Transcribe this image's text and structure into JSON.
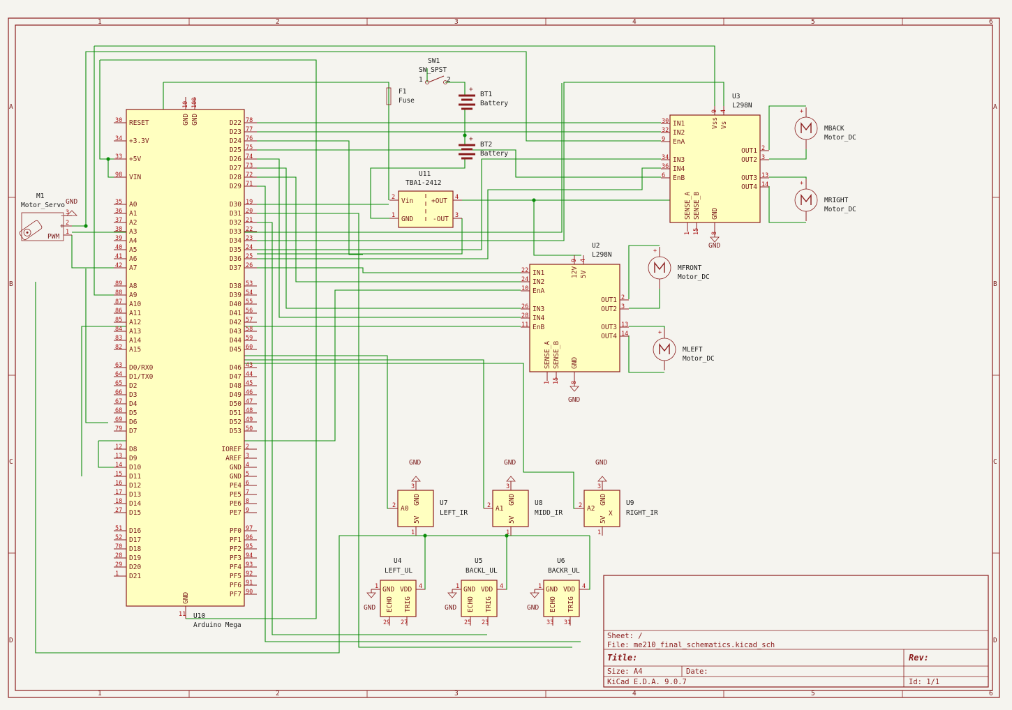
{
  "frame": {
    "col_labels": [
      "1",
      "2",
      "3",
      "4",
      "5",
      "6"
    ],
    "row_labels": [
      "A",
      "B",
      "C",
      "D"
    ]
  },
  "title_block": {
    "sheet": "Sheet: /",
    "file": "File: me210_final_schematics.kicad_sch",
    "title": "Title:",
    "size": "Size: A4",
    "date": "Date:",
    "rev": "Rev:",
    "tool": "KiCad E.D.A. 9.0.7",
    "id": "Id: 1/1"
  },
  "components": {
    "u10": {
      "ref": "U10",
      "value": "Arduino Mega",
      "left_pins": [
        {
          "name": "RESET",
          "num": "30"
        },
        {
          "name": "+3.3V",
          "num": "34"
        },
        {
          "name": "+5V",
          "num": "33"
        },
        {
          "name": "VIN",
          "num": "98"
        },
        {
          "name": "A0",
          "num": "35"
        },
        {
          "name": "A1",
          "num": "36"
        },
        {
          "name": "A2",
          "num": "37"
        },
        {
          "name": "A3",
          "num": "38"
        },
        {
          "name": "A4",
          "num": "39"
        },
        {
          "name": "A5",
          "num": "40"
        },
        {
          "name": "A6",
          "num": "41"
        },
        {
          "name": "A7",
          "num": "42"
        },
        {
          "name": "A8",
          "num": "89"
        },
        {
          "name": "A9",
          "num": "88"
        },
        {
          "name": "A10",
          "num": "87"
        },
        {
          "name": "A11",
          "num": "86"
        },
        {
          "name": "A12",
          "num": "85"
        },
        {
          "name": "A13",
          "num": "84"
        },
        {
          "name": "A14",
          "num": "83"
        },
        {
          "name": "A15",
          "num": "82"
        },
        {
          "name": "D0/RX0",
          "num": "63"
        },
        {
          "name": "D1/TX0",
          "num": "64"
        },
        {
          "name": "D2",
          "num": "65"
        },
        {
          "name": "D3",
          "num": "66"
        },
        {
          "name": "D4",
          "num": "67"
        },
        {
          "name": "D5",
          "num": "68"
        },
        {
          "name": "D6",
          "num": "69"
        },
        {
          "name": "D7",
          "num": "79"
        },
        {
          "name": "D8",
          "num": "12"
        },
        {
          "name": "D9",
          "num": "13"
        },
        {
          "name": "D10",
          "num": "14"
        },
        {
          "name": "D11",
          "num": "15"
        },
        {
          "name": "D12",
          "num": "16"
        },
        {
          "name": "D13",
          "num": "17"
        },
        {
          "name": "D14",
          "num": "18"
        },
        {
          "name": "D15",
          "num": "27"
        },
        {
          "name": "D16",
          "num": "51"
        },
        {
          "name": "D17",
          "num": "52"
        },
        {
          "name": "D18",
          "num": "70"
        },
        {
          "name": "D19",
          "num": "28"
        },
        {
          "name": "D20",
          "num": "29"
        },
        {
          "name": "D21",
          "num": "1"
        }
      ],
      "right_pins": [
        {
          "name": "D22",
          "num": "78"
        },
        {
          "name": "D23",
          "num": "77"
        },
        {
          "name": "D24",
          "num": "76"
        },
        {
          "name": "D25",
          "num": "75"
        },
        {
          "name": "D26",
          "num": "74"
        },
        {
          "name": "D27",
          "num": "73"
        },
        {
          "name": "D28",
          "num": "72"
        },
        {
          "name": "D29",
          "num": "71"
        },
        {
          "name": "D30",
          "num": "19"
        },
        {
          "name": "D31",
          "num": "20"
        },
        {
          "name": "D32",
          "num": "21"
        },
        {
          "name": "D33",
          "num": "22"
        },
        {
          "name": "D34",
          "num": "23"
        },
        {
          "name": "D35",
          "num": "24"
        },
        {
          "name": "D36",
          "num": "25"
        },
        {
          "name": "D37",
          "num": "26"
        },
        {
          "name": "D38",
          "num": "53"
        },
        {
          "name": "D39",
          "num": "54"
        },
        {
          "name": "D40",
          "num": "55"
        },
        {
          "name": "D41",
          "num": "56"
        },
        {
          "name": "D42",
          "num": "57"
        },
        {
          "name": "D43",
          "num": "58"
        },
        {
          "name": "D44",
          "num": "59"
        },
        {
          "name": "D45",
          "num": "60"
        },
        {
          "name": "D46",
          "num": "43"
        },
        {
          "name": "D47",
          "num": "44"
        },
        {
          "name": "D48",
          "num": "45"
        },
        {
          "name": "D49",
          "num": "46"
        },
        {
          "name": "D50",
          "num": "47"
        },
        {
          "name": "D51",
          "num": "48"
        },
        {
          "name": "D52",
          "num": "49"
        },
        {
          "name": "D53",
          "num": "50"
        },
        {
          "name": "IOREF",
          "num": "2"
        },
        {
          "name": "AREF",
          "num": "3"
        },
        {
          "name": "GND",
          "num": "4"
        },
        {
          "name": "GND",
          "num": "5"
        },
        {
          "name": "PE4",
          "num": "6"
        },
        {
          "name": "PE5",
          "num": "7"
        },
        {
          "name": "PE6",
          "num": "8"
        },
        {
          "name": "PE7",
          "num": "9"
        },
        {
          "name": "PF0",
          "num": "97"
        },
        {
          "name": "PF1",
          "num": "96"
        },
        {
          "name": "PF2",
          "num": "95"
        },
        {
          "name": "PF3",
          "num": "94"
        },
        {
          "name": "PF4",
          "num": "93"
        },
        {
          "name": "PF5",
          "num": "92"
        },
        {
          "name": "PF6",
          "num": "91"
        },
        {
          "name": "PF7",
          "num": "90"
        }
      ],
      "top_pins": [
        {
          "name": "GND",
          "num": "10"
        },
        {
          "name": "GND",
          "num": "100"
        }
      ],
      "bottom_pin": {
        "name": "GND",
        "num": "11"
      }
    },
    "m1": {
      "ref": "M1",
      "value": "Motor_Servo",
      "pins": [
        {
          "name": "-",
          "num": "3"
        },
        {
          "name": "+",
          "num": "2"
        },
        {
          "name": "PWM",
          "num": "1"
        }
      ],
      "gnd": "GND"
    },
    "sw1": {
      "ref": "SW1",
      "value": "SW_SPST",
      "pin1": "1",
      "pin2": "2"
    },
    "f1": {
      "ref": "F1",
      "value": "Fuse"
    },
    "bt1": {
      "ref": "BT1",
      "value": "Battery",
      "plus": "+"
    },
    "bt2": {
      "ref": "BT2",
      "value": "Battery",
      "plus": "+"
    },
    "u11": {
      "ref": "U11",
      "value": "TBA1-2412",
      "pins": [
        {
          "name": "Vin",
          "num": "2"
        },
        {
          "name": "GND",
          "num": "1"
        },
        {
          "name": "+OUT",
          "num": "4"
        },
        {
          "name": "-OUT",
          "num": "3"
        }
      ]
    },
    "u3": {
      "ref": "U3",
      "value": "L298N",
      "left": [
        {
          "name": "IN1",
          "num": "30"
        },
        {
          "name": "IN2",
          "num": "32"
        },
        {
          "name": "EnA",
          "num": "9"
        },
        {
          "name": "IN3",
          "num": "34"
        },
        {
          "name": "IN4",
          "num": "36"
        },
        {
          "name": "EnB",
          "num": "6"
        }
      ],
      "right": [
        {
          "name": "OUT1",
          "num": "2"
        },
        {
          "name": "OUT2",
          "num": "3"
        },
        {
          "name": "OUT3",
          "num": "13"
        },
        {
          "name": "OUT4",
          "num": "14"
        }
      ],
      "top": [
        {
          "name": "Vss",
          "num": "9"
        },
        {
          "name": "Vs",
          "num": "4"
        }
      ],
      "bottom": [
        {
          "name": "SENSE_A",
          "num": "1"
        },
        {
          "name": "SENSE_B",
          "num": "15"
        },
        {
          "name": "GND",
          "num": "8"
        }
      ],
      "gnd": "GND"
    },
    "u2": {
      "ref": "U2",
      "value": "L298N",
      "left": [
        {
          "name": "IN1",
          "num": "22"
        },
        {
          "name": "IN2",
          "num": "24"
        },
        {
          "name": "EnA",
          "num": "10"
        },
        {
          "name": "IN3",
          "num": "26"
        },
        {
          "name": "IN4",
          "num": "28"
        },
        {
          "name": "EnB",
          "num": "11"
        }
      ],
      "right": [
        {
          "name": "OUT1",
          "num": "2"
        },
        {
          "name": "OUT2",
          "num": "3"
        },
        {
          "name": "OUT3",
          "num": "13"
        },
        {
          "name": "OUT4",
          "num": "14"
        }
      ],
      "top": [
        {
          "name": "12V",
          "num": "9"
        },
        {
          "name": "5V",
          "num": "4"
        }
      ],
      "bottom": [
        {
          "name": "SENSE_A",
          "num": "1"
        },
        {
          "name": "SENSE_B",
          "num": "15"
        },
        {
          "name": "GND",
          "num": "8"
        }
      ],
      "gnd": "GND"
    },
    "motors": [
      {
        "ref": "MBACK",
        "value": "Motor_DC"
      },
      {
        "ref": "MRIGHT",
        "value": "Motor_DC"
      },
      {
        "ref": "MFRONT",
        "value": "Motor_DC"
      },
      {
        "ref": "MLEFT",
        "value": "Motor_DC"
      }
    ],
    "ir": [
      {
        "ref": "U7",
        "value": "LEFT_IR",
        "sig": "A0",
        "sig_num": "2",
        "gnd": "GND",
        "gnd_num": "3",
        "v": "5V",
        "v_num": "1"
      },
      {
        "ref": "U8",
        "value": "MIDD_IR",
        "sig": "A1",
        "sig_num": "2",
        "gnd": "GND",
        "gnd_num": "3",
        "v": "5V",
        "v_num": "1"
      },
      {
        "ref": "U9",
        "value": "RIGHT_IR",
        "sig": "A2",
        "sig_num": "2",
        "gnd": "GND",
        "gnd_num": "3",
        "v": "5V",
        "v_num": "1",
        "extra": "X"
      }
    ],
    "ul": [
      {
        "ref": "U4",
        "value": "LEFT_UL",
        "echo_num": "29",
        "trig_num": "27"
      },
      {
        "ref": "U5",
        "value": "BACKL_UL",
        "echo_num": "25",
        "trig_num": "23"
      },
      {
        "ref": "U6",
        "value": "BACKR_UL",
        "echo_num": "33",
        "trig_num": "31"
      }
    ],
    "ul_pins": {
      "gnd": "GND",
      "vdd": "VDD",
      "echo": "ECHO",
      "trig": "TRIG",
      "gnd_num": "1",
      "vdd_num": "4"
    },
    "gnd_label": "GND"
  },
  "colors": {
    "frame": "#8a1c1c",
    "wire": "#0a8c0a",
    "body": "#ffffc0",
    "background": "#f5f4ef"
  }
}
